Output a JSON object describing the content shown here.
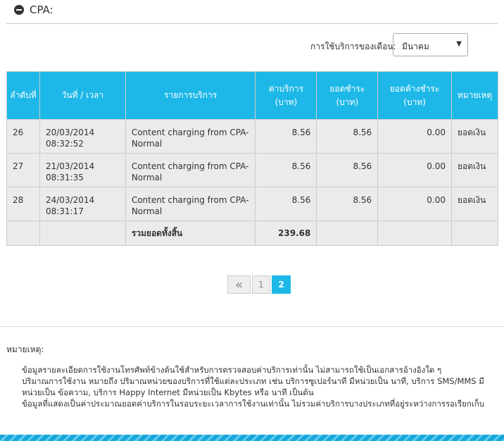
{
  "section": {
    "title": "CPA:"
  },
  "filter": {
    "label": "การใช้บริการของเดือน:",
    "selected": "มีนาคม"
  },
  "table": {
    "headers": [
      "ลำดับที่",
      "วันที่ / เวลา",
      "รายการบริการ",
      "ค่าบริการ (บาท)",
      "ยอดชำระ (บาท)",
      "ยอดค้างชำระ (บาท)",
      "หมายเหตุ"
    ],
    "rows": [
      {
        "no": "26",
        "date": "20/03/2014",
        "time": "08:32:52",
        "item": "Content charging from CPA-Normal",
        "fee": "8.56",
        "paid": "8.56",
        "due": "0.00",
        "note": "ยอดเงิน"
      },
      {
        "no": "27",
        "date": "21/03/2014",
        "time": "08:31:35",
        "item": "Content charging from CPA-Normal",
        "fee": "8.56",
        "paid": "8.56",
        "due": "0.00",
        "note": "ยอดเงิน"
      },
      {
        "no": "28",
        "date": "24/03/2014",
        "time": "08:31:17",
        "item": "Content charging from CPA-Normal",
        "fee": "8.56",
        "paid": "8.56",
        "due": "0.00",
        "note": "ยอดเงิน"
      }
    ],
    "total_label": "รวมยอดทั้งสิ้น",
    "total_value": "239.68"
  },
  "pagination": {
    "first": "«",
    "pages": [
      "1",
      "2"
    ],
    "current": "2"
  },
  "notes": {
    "title": "หมายเหตุ:",
    "lines": [
      "ข้อมูลรายละเอียดการใช้งานโทรศัพท์ข้างต้นใช้สำหรับการตรวจสอบค่าบริการเท่านั้น ไม่สามารถใช้เป็นเอกสารอ้างอิงใด ๆ",
      "ปริมาณการใช้งาน หมายถึง ปริมาณหน่วยของบริการที่ใช้แต่ละประเภท เช่น บริการซูเปอร์นาที มีหน่วยเป็น นาที, บริการ SMS/MMS มีหน่วยเป็น ข้อความ, บริการ Happy Internet มีหน่วยเป็น Kbytes หรือ นาที เป็นต้น",
      "ข้อมูลที่แสดงเป็นค่าประมาณยอดค่าบริการในรอบระยะเวลาการใช้งานเท่านั้น ไม่รวมค่าบริการบางประเภทที่อยู่ระหว่างการรอเรียกเก็บ"
    ]
  }
}
